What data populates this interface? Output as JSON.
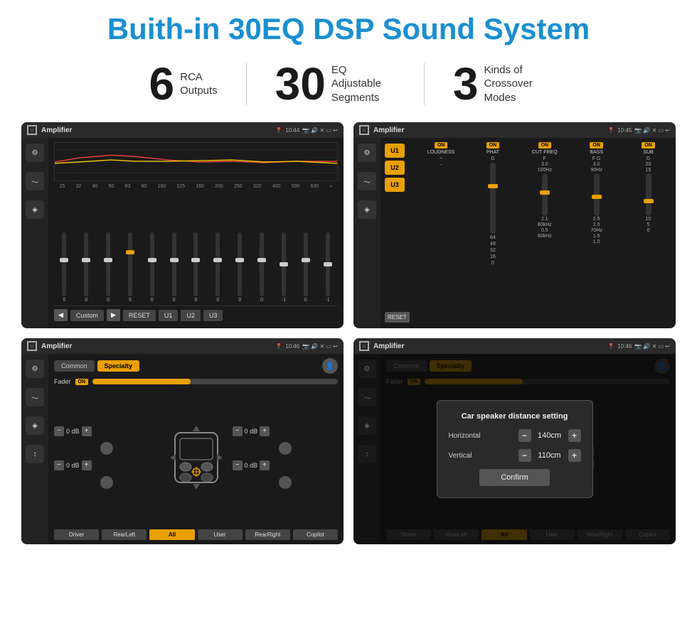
{
  "header": {
    "title": "Buith-in 30EQ DSP Sound System"
  },
  "stats": [
    {
      "number": "6",
      "label": "RCA\nOutputs"
    },
    {
      "number": "30",
      "label": "EQ Adjustable\nSegments"
    },
    {
      "number": "3",
      "label": "Kinds of\nCrossover Modes"
    }
  ],
  "screens": [
    {
      "id": "screen1",
      "statusTitle": "Amplifier",
      "time": "10:44",
      "eq_freqs": [
        "25",
        "32",
        "40",
        "50",
        "63",
        "80",
        "100",
        "125",
        "160",
        "200",
        "250",
        "320",
        "400",
        "500",
        "630"
      ],
      "eq_values": [
        "0",
        "0",
        "0",
        "5",
        "0",
        "0",
        "0",
        "0",
        "0",
        "0",
        "-1",
        "0",
        "-1"
      ],
      "presets": [
        "Custom",
        "RESET",
        "U1",
        "U2",
        "U3"
      ]
    },
    {
      "id": "screen2",
      "statusTitle": "Amplifier",
      "time": "10:45",
      "uButtons": [
        "U1",
        "U2",
        "U3"
      ],
      "channels": [
        "LOUDNESS",
        "PHAT",
        "CUT FREQ",
        "BASS",
        "SUB"
      ],
      "resetLabel": "RESET"
    },
    {
      "id": "screen3",
      "statusTitle": "Amplifier",
      "time": "10:46",
      "tabs": [
        "Common",
        "Specialty"
      ],
      "faderLabel": "Fader",
      "faderOn": "ON",
      "controls": {
        "topLeft": "0 dB",
        "topRight": "0 dB",
        "midLeft": "0 dB",
        "midRight": "0 dB"
      },
      "bottomBtns": [
        "Driver",
        "RearLeft",
        "All",
        "User",
        "RearRight",
        "Copilot"
      ]
    },
    {
      "id": "screen4",
      "statusTitle": "Amplifier",
      "time": "10:46",
      "tabs": [
        "Common",
        "Specialty"
      ],
      "dialog": {
        "title": "Car speaker distance setting",
        "horizontal": {
          "label": "Horizontal",
          "value": "140cm"
        },
        "vertical": {
          "label": "Vertical",
          "value": "110cm"
        },
        "confirmLabel": "Confirm"
      },
      "bottomBtns": [
        "Driver",
        "RearLeft",
        "All",
        "User",
        "RearRight",
        "Copilot"
      ]
    }
  ]
}
